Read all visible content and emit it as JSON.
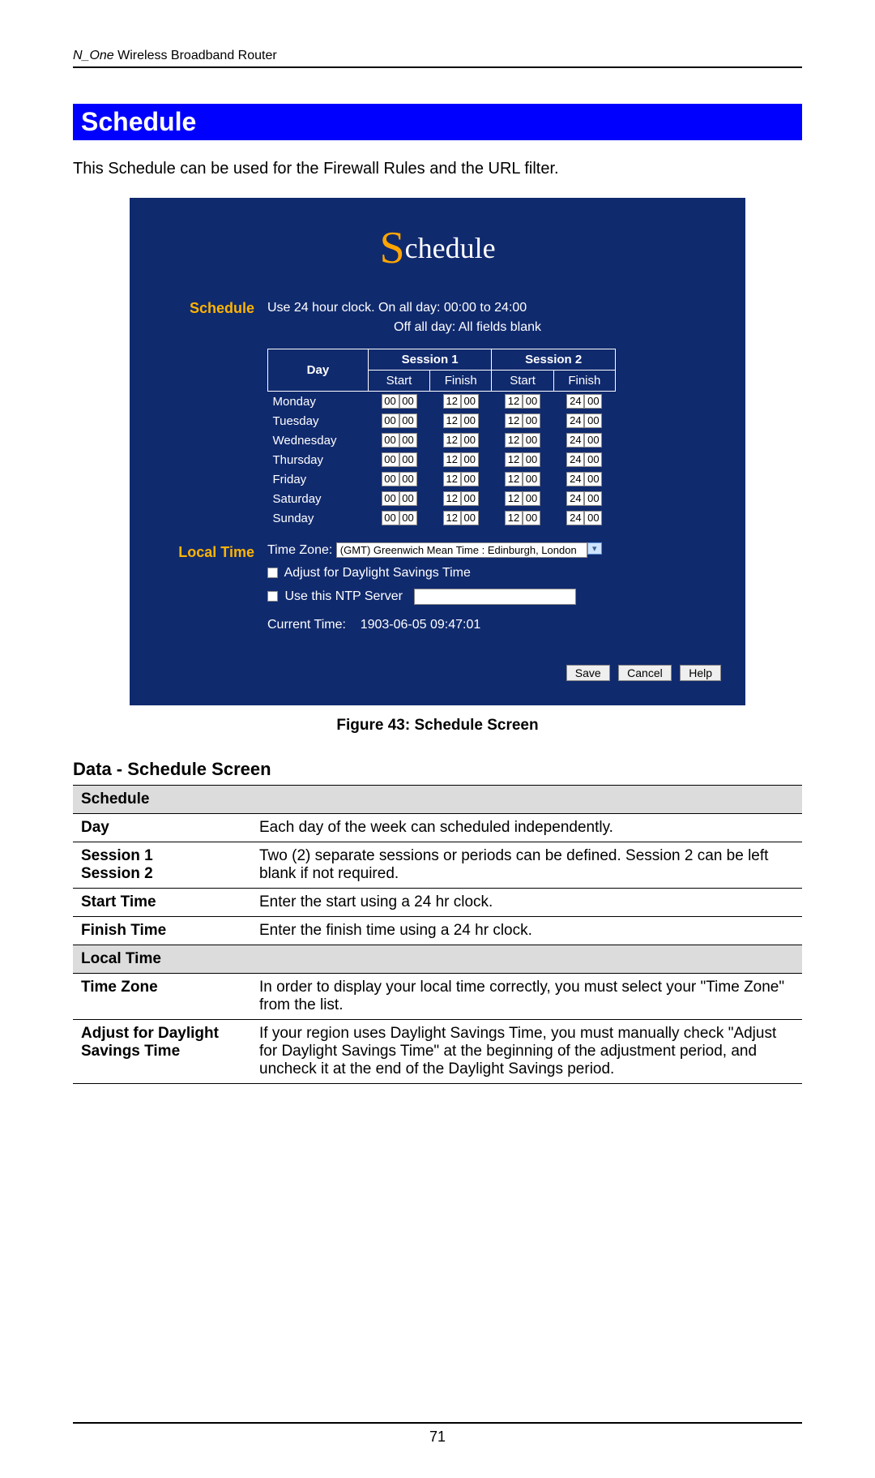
{
  "header": {
    "product_italic": "N_One",
    "product_rest": " Wireless Broadband Router"
  },
  "section_title": "Schedule",
  "intro": "This Schedule can be used for the Firewall Rules and the URL filter.",
  "screenshot": {
    "logo_prefix": "S",
    "logo_rest": "chedule",
    "labels": {
      "schedule": "Schedule",
      "local_time": "Local Time"
    },
    "clock_help_1": "Use 24 hour clock.   On all day: 00:00 to 24:00",
    "clock_help_2": "Off all day: All fields blank",
    "table": {
      "day_head": "Day",
      "session1_head": "Session 1",
      "session2_head": "Session 2",
      "start": "Start",
      "finish": "Finish",
      "days": [
        "Monday",
        "Tuesday",
        "Wednesday",
        "Thursday",
        "Friday",
        "Saturday",
        "Sunday"
      ],
      "s1_start_h": "00",
      "s1_start_m": "00",
      "s1_finish_h": "12",
      "s1_finish_m": "00",
      "s2_start_h": "12",
      "s2_start_m": "00",
      "s2_finish_h": "24",
      "s2_finish_m": "00"
    },
    "timezone_label": "Time Zone:",
    "timezone_value": "(GMT) Greenwich Mean Time : Edinburgh, London",
    "dst_label": "Adjust for Daylight Savings Time",
    "ntp_label": "Use this NTP Server",
    "current_time_label": "Current Time:",
    "current_time_value": "1903-06-05 09:47:01",
    "buttons": {
      "save": "Save",
      "cancel": "Cancel",
      "help": "Help"
    }
  },
  "caption": "Figure 43: Schedule Screen",
  "data_heading": "Data - Schedule Screen",
  "data_table": {
    "cat1": "Schedule",
    "rows1": [
      {
        "label": "Day",
        "desc": "Each day of the week can scheduled independently."
      },
      {
        "label": "Session 1\nSession 2",
        "desc": "Two (2) separate sessions or periods can be defined. Session 2 can be left blank if not required."
      },
      {
        "label": "Start Time",
        "desc": "Enter the start using a 24 hr clock."
      },
      {
        "label": "Finish Time",
        "desc": "Enter the finish time using a 24 hr clock."
      }
    ],
    "cat2": "Local Time",
    "rows2": [
      {
        "label": "Time Zone",
        "desc": "In order to display your local time correctly, you must select your \"Time Zone\" from the list."
      },
      {
        "label": "Adjust for Daylight Savings Time",
        "desc": "If your region uses Daylight Savings Time, you must manually check \"Adjust for Daylight Savings Time\" at the beginning of the adjustment period, and uncheck it at the end of the Daylight Savings period."
      }
    ]
  },
  "page_number": "71"
}
